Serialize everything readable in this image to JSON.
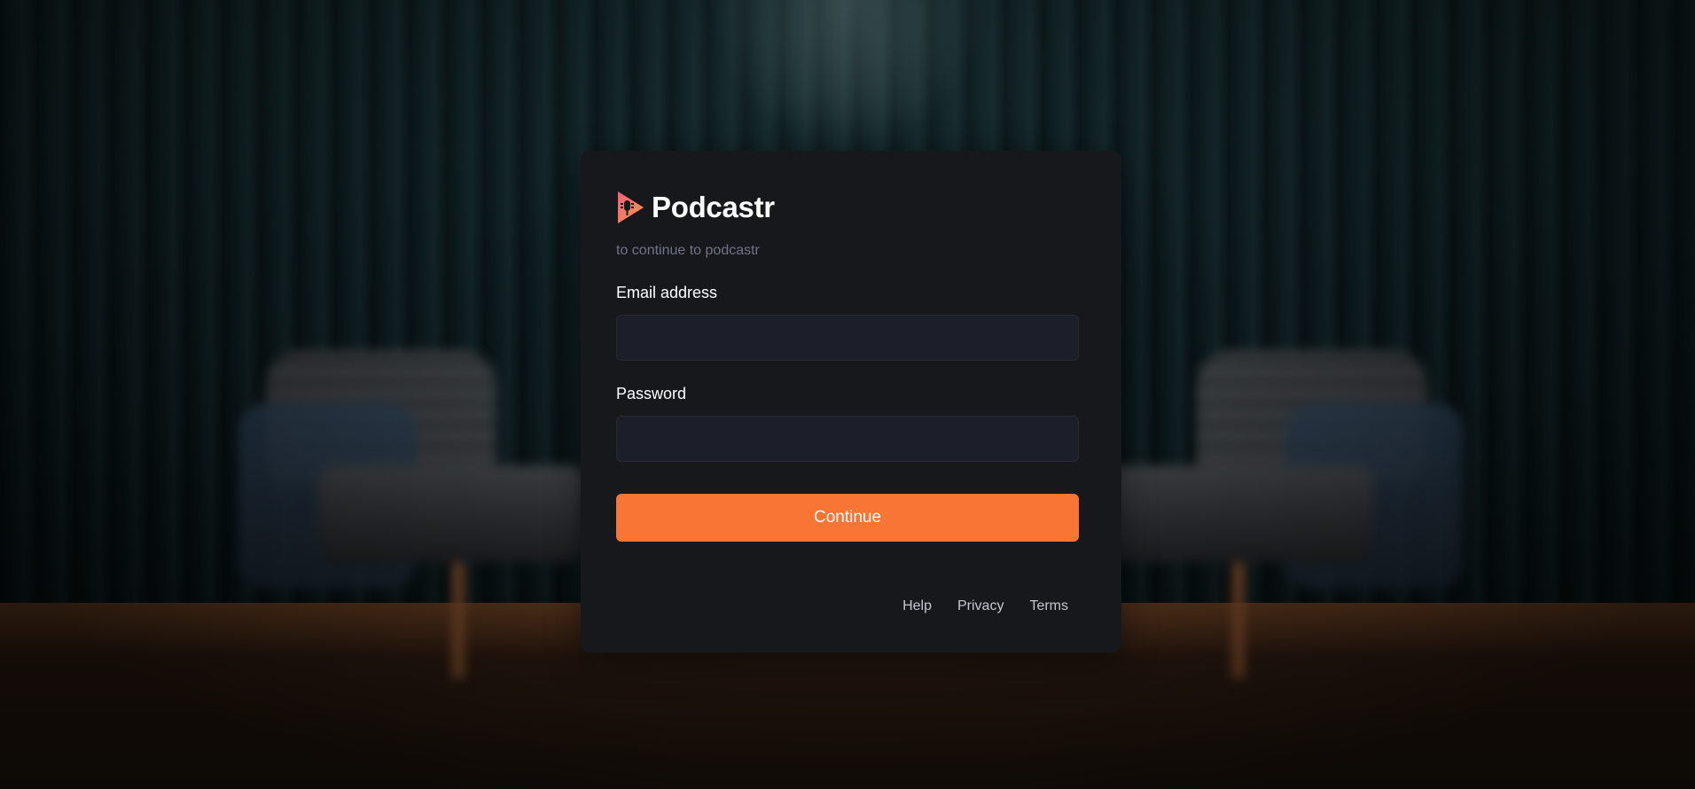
{
  "brand": {
    "name": "Podcastr",
    "icon": "podcastr-logo-icon",
    "colors": {
      "logo_pink": "#f16a7a",
      "logo_orange": "#f98a4a"
    }
  },
  "subtitle": "to continue to podcastr",
  "form": {
    "email_label": "Email address",
    "email_value": "",
    "password_label": "Password",
    "password_value": "",
    "continue_label": "Continue"
  },
  "footer": {
    "links": [
      "Help",
      "Privacy",
      "Terms"
    ]
  },
  "theme": {
    "card_bg": "#17181c",
    "input_bg": "#1c1f29",
    "accent": "#f97535",
    "muted_text": "#6f7486"
  }
}
